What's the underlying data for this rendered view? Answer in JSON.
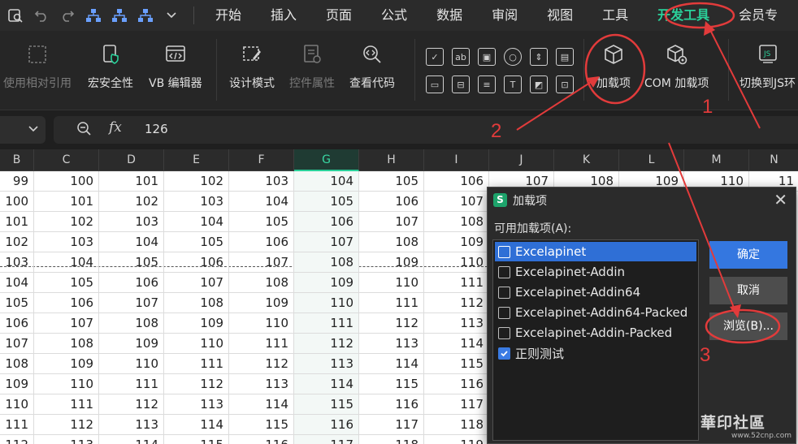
{
  "menubar": {
    "tabs": [
      "开始",
      "插入",
      "页面",
      "公式",
      "数据",
      "审阅",
      "视图",
      "工具",
      "开发工具",
      "会员专"
    ],
    "active_tab": "开发工具"
  },
  "ribbon": {
    "relative_ref": "使用相对引用",
    "macro_security": "宏安全性",
    "vb_editor": "VB 编辑器",
    "design_mode": "设计模式",
    "control_props": "控件属性",
    "view_code": "查看代码",
    "addins": "加载项",
    "com_addins": "COM 加载项",
    "switch_js": "切换到JS环"
  },
  "formula": {
    "value": "126",
    "fx": "fx"
  },
  "grid": {
    "columns": [
      "B",
      "C",
      "D",
      "E",
      "F",
      "G",
      "H",
      "I",
      "J",
      "K",
      "L",
      "M",
      "N"
    ],
    "selected_column": "G",
    "visible_values_j_to_n": [
      "107",
      "108",
      "109",
      "110",
      "11"
    ],
    "rows": [
      [
        "99",
        "100",
        "101",
        "102",
        "103",
        "104",
        "105",
        "106"
      ],
      [
        "100",
        "101",
        "102",
        "103",
        "104",
        "105",
        "106",
        "107"
      ],
      [
        "101",
        "102",
        "103",
        "104",
        "105",
        "106",
        "107",
        "108"
      ],
      [
        "102",
        "103",
        "104",
        "105",
        "106",
        "107",
        "108",
        "109"
      ],
      [
        "103",
        "104",
        "105",
        "106",
        "107",
        "108",
        "109",
        "110"
      ],
      [
        "104",
        "105",
        "106",
        "107",
        "108",
        "109",
        "110",
        "111"
      ],
      [
        "105",
        "106",
        "107",
        "108",
        "109",
        "110",
        "111",
        "112"
      ],
      [
        "106",
        "107",
        "108",
        "109",
        "110",
        "111",
        "112",
        "113"
      ],
      [
        "107",
        "108",
        "109",
        "110",
        "111",
        "112",
        "113",
        "114"
      ],
      [
        "108",
        "109",
        "110",
        "111",
        "112",
        "113",
        "114",
        "115"
      ],
      [
        "109",
        "110",
        "111",
        "112",
        "113",
        "114",
        "115",
        "116"
      ],
      [
        "110",
        "111",
        "112",
        "113",
        "114",
        "115",
        "116",
        "117"
      ],
      [
        "111",
        "112",
        "113",
        "114",
        "115",
        "116",
        "117",
        "118"
      ],
      [
        "112",
        "113",
        "114",
        "115",
        "116",
        "117",
        "118",
        "119"
      ]
    ]
  },
  "dialog": {
    "title": "加载项",
    "logo": "S",
    "label": "可用加载项(A):",
    "items": [
      {
        "label": "Excelapinet",
        "checked": false
      },
      {
        "label": "Excelapinet-Addin",
        "checked": false
      },
      {
        "label": "Excelapinet-Addin64",
        "checked": false
      },
      {
        "label": "Excelapinet-Addin64-Packed",
        "checked": false
      },
      {
        "label": "Excelapinet-Addin-Packed",
        "checked": false
      },
      {
        "label": "正则测试",
        "checked": true
      }
    ],
    "ok": "确定",
    "cancel": "取消",
    "browse": "浏览(B)...",
    "close": "✕"
  },
  "annotations": {
    "n1": "1",
    "n2": "2",
    "n3": "3",
    "color": "#e23b3b"
  },
  "watermark": {
    "text": "華印社區",
    "url": "www.52cnp.com"
  }
}
